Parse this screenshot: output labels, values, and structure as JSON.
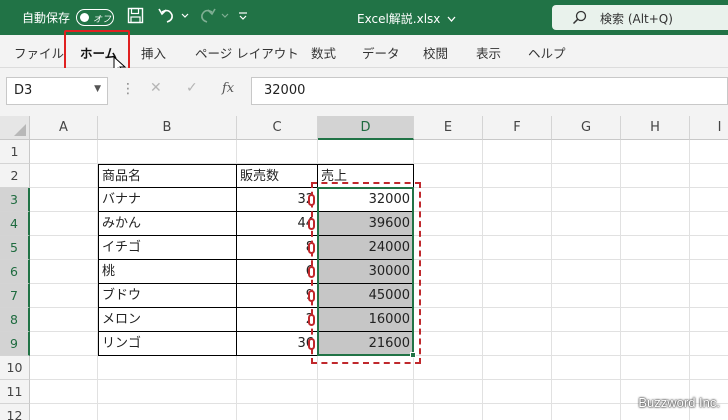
{
  "titlebar": {
    "autosave_label": "自動保存",
    "autosave_state": "オフ",
    "document_title": "Excel解説.xlsx",
    "search_placeholder": "検索 (Alt+Q)",
    "bg_color": "#217346"
  },
  "ribbon": {
    "tabs": [
      "ファイル",
      "ホーム",
      "挿入",
      "ページ レイアウト",
      "数式",
      "データ",
      "校閲",
      "表示",
      "ヘルプ"
    ],
    "active_tab": "ホーム",
    "highlight_color": "#e02020"
  },
  "formula_bar": {
    "name_box": "D3",
    "fx_label": "fx",
    "formula": "32000"
  },
  "sheet": {
    "columns": [
      "A",
      "B",
      "C",
      "D",
      "E",
      "F",
      "G",
      "H",
      "I"
    ],
    "rows": [
      "1",
      "2",
      "3",
      "4",
      "5",
      "6",
      "7",
      "8",
      "9",
      "10",
      "11",
      "12"
    ],
    "selected_column": "D",
    "selected_range": "D3:D9",
    "table": {
      "headers": [
        "商品名",
        "販売数",
        "売上"
      ],
      "rows": [
        [
          "バナナ",
          "32",
          "32000"
        ],
        [
          "みかん",
          "44",
          "39600"
        ],
        [
          "イチゴ",
          "8",
          "24000"
        ],
        [
          "桃",
          "6",
          "30000"
        ],
        [
          "ブドウ",
          "9",
          "45000"
        ],
        [
          "メロン",
          "2",
          "16000"
        ],
        [
          "リンゴ",
          "36",
          "21600"
        ]
      ]
    }
  },
  "watermark": "Buzzword Inc."
}
